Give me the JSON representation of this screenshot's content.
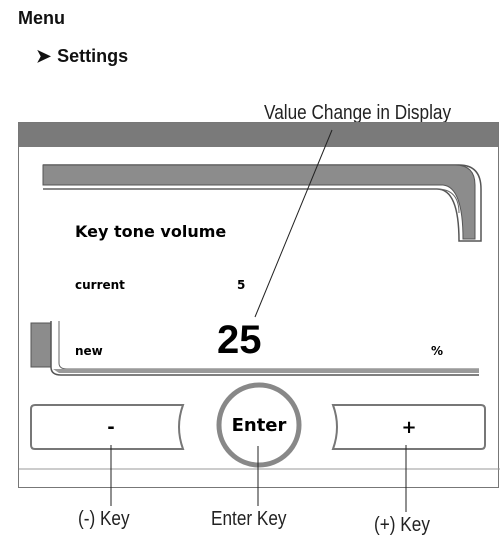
{
  "breadcrumb": {
    "menu": "Menu",
    "arrow": "➤",
    "settings": "Settings"
  },
  "callouts": {
    "display": "Value Change in Display",
    "minus_key": "(-) Key",
    "enter_key": "Enter Key",
    "plus_key": "(+) Key"
  },
  "screen": {
    "title": "Key tone volume",
    "current_label": "current",
    "current_value": "5",
    "new_label": "new",
    "new_value": "25",
    "unit": "%"
  },
  "buttons": {
    "minus": "-",
    "enter": "Enter",
    "plus": "+"
  }
}
